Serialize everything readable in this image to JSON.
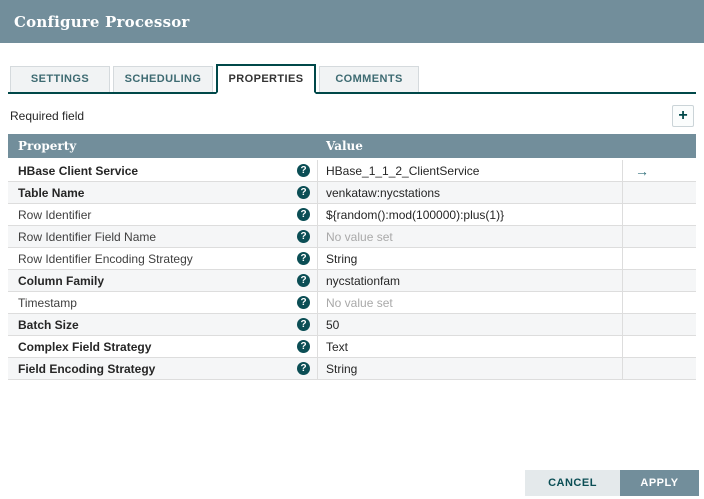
{
  "dialog": {
    "title": "Configure Processor"
  },
  "tabs": [
    {
      "label": "SETTINGS",
      "active": false
    },
    {
      "label": "SCHEDULING",
      "active": false
    },
    {
      "label": "PROPERTIES",
      "active": true
    },
    {
      "label": "COMMENTS",
      "active": false
    }
  ],
  "toolbar": {
    "required_field_label": "Required field"
  },
  "icons": {
    "add_glyph": "+",
    "help_glyph": "?",
    "goto_glyph": "→"
  },
  "table": {
    "columns": [
      "Property",
      "Value"
    ],
    "rows": [
      {
        "property": "HBase Client Service",
        "required": true,
        "value": "HBase_1_1_2_ClientService",
        "no_value": false,
        "has_goto": true
      },
      {
        "property": "Table Name",
        "required": true,
        "value": "venkataw:nycstations",
        "no_value": false,
        "has_goto": false
      },
      {
        "property": "Row Identifier",
        "required": false,
        "value": "${random():mod(100000):plus(1)}",
        "no_value": false,
        "has_goto": false
      },
      {
        "property": "Row Identifier Field Name",
        "required": false,
        "value": "No value set",
        "no_value": true,
        "has_goto": false
      },
      {
        "property": "Row Identifier Encoding Strategy",
        "required": false,
        "value": "String",
        "no_value": false,
        "has_goto": false
      },
      {
        "property": "Column Family",
        "required": true,
        "value": "nycstationfam",
        "no_value": false,
        "has_goto": false
      },
      {
        "property": "Timestamp",
        "required": false,
        "value": "No value set",
        "no_value": true,
        "has_goto": false
      },
      {
        "property": "Batch Size",
        "required": true,
        "value": "50",
        "no_value": false,
        "has_goto": false
      },
      {
        "property": "Complex Field Strategy",
        "required": true,
        "value": "Text",
        "no_value": false,
        "has_goto": false
      },
      {
        "property": "Field Encoding Strategy",
        "required": true,
        "value": "String",
        "no_value": false,
        "has_goto": false
      }
    ]
  },
  "footer": {
    "cancel_label": "CANCEL",
    "apply_label": "APPLY"
  },
  "colors": {
    "header_bg": "#728E9B",
    "accent_teal": "#004849",
    "table_header_bg": "#728E9B",
    "row_alt_bg": "#F5F6F7",
    "cancel_bg": "#E4E9EB",
    "apply_bg": "#728E9B",
    "no_value_text": "#A9A9A9",
    "goto_icon": "#31707B"
  }
}
